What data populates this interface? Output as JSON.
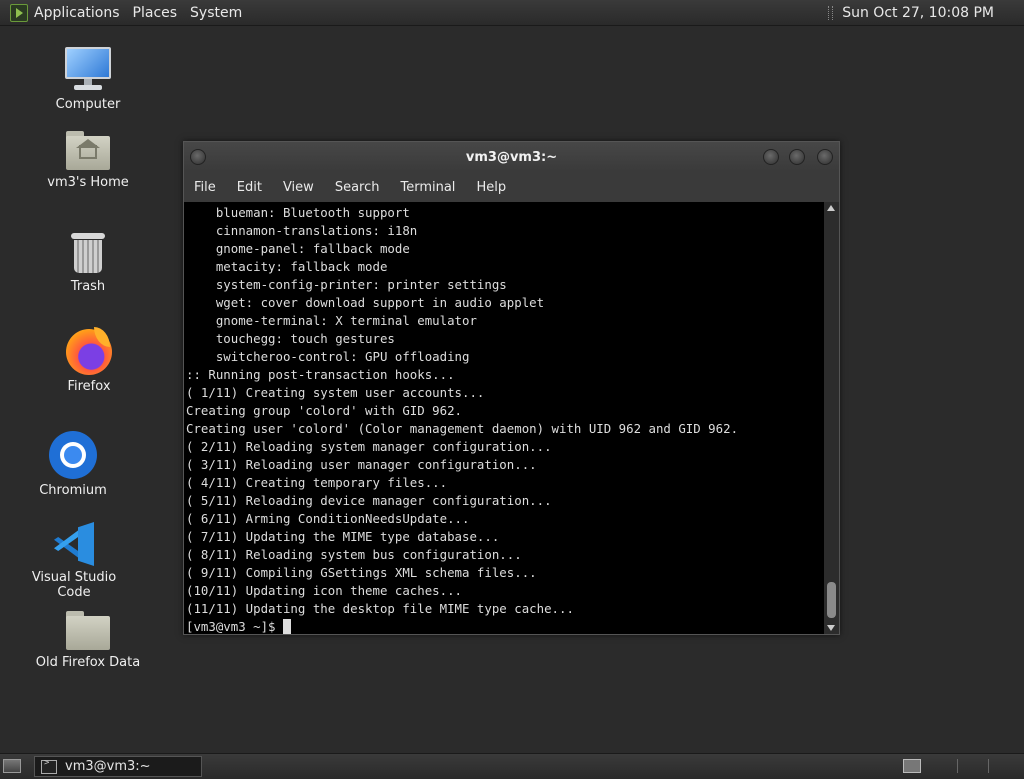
{
  "top_panel": {
    "menus": [
      "Applications",
      "Places",
      "System"
    ],
    "clock": "Sun Oct 27, 10:08 PM"
  },
  "desktop_icons": [
    {
      "label": "Computer",
      "icon": "computer-icon"
    },
    {
      "label": "vm3's Home",
      "icon": "home-folder-icon"
    },
    {
      "label": "Trash",
      "icon": "trash-icon"
    },
    {
      "label": "Firefox",
      "icon": "firefox-icon"
    },
    {
      "label": "Chromium",
      "icon": "chromium-icon"
    },
    {
      "label": "Visual Studio Code",
      "icon": "vscode-icon"
    },
    {
      "label": "Old Firefox Data",
      "icon": "folder-icon"
    }
  ],
  "terminal": {
    "title": "vm3@vm3:~",
    "menu": [
      "File",
      "Edit",
      "View",
      "Search",
      "Terminal",
      "Help"
    ],
    "lines": [
      "    blueman: Bluetooth support",
      "    cinnamon-translations: i18n",
      "    gnome-panel: fallback mode",
      "    metacity: fallback mode",
      "    system-config-printer: printer settings",
      "    wget: cover download support in audio applet",
      "    gnome-terminal: X terminal emulator",
      "    touchegg: touch gestures",
      "    switcheroo-control: GPU offloading",
      ":: Running post-transaction hooks...",
      "( 1/11) Creating system user accounts...",
      "Creating group 'colord' with GID 962.",
      "Creating user 'colord' (Color management daemon) with UID 962 and GID 962.",
      "( 2/11) Reloading system manager configuration...",
      "( 3/11) Reloading user manager configuration...",
      "( 4/11) Creating temporary files...",
      "( 5/11) Reloading device manager configuration...",
      "( 6/11) Arming ConditionNeedsUpdate...",
      "( 7/11) Updating the MIME type database...",
      "( 8/11) Reloading system bus configuration...",
      "( 9/11) Compiling GSettings XML schema files...",
      "(10/11) Updating icon theme caches...",
      "(11/11) Updating the desktop file MIME type cache..."
    ],
    "prompt": "[vm3@vm3 ~]$ "
  },
  "taskbar": {
    "tasks": [
      {
        "label": "vm3@vm3:~",
        "icon": "terminal-icon"
      }
    ]
  },
  "colors": {
    "desktop_bg": "#2b2b2b",
    "terminal_bg": "#000000",
    "terminal_fg": "#dddddd"
  }
}
